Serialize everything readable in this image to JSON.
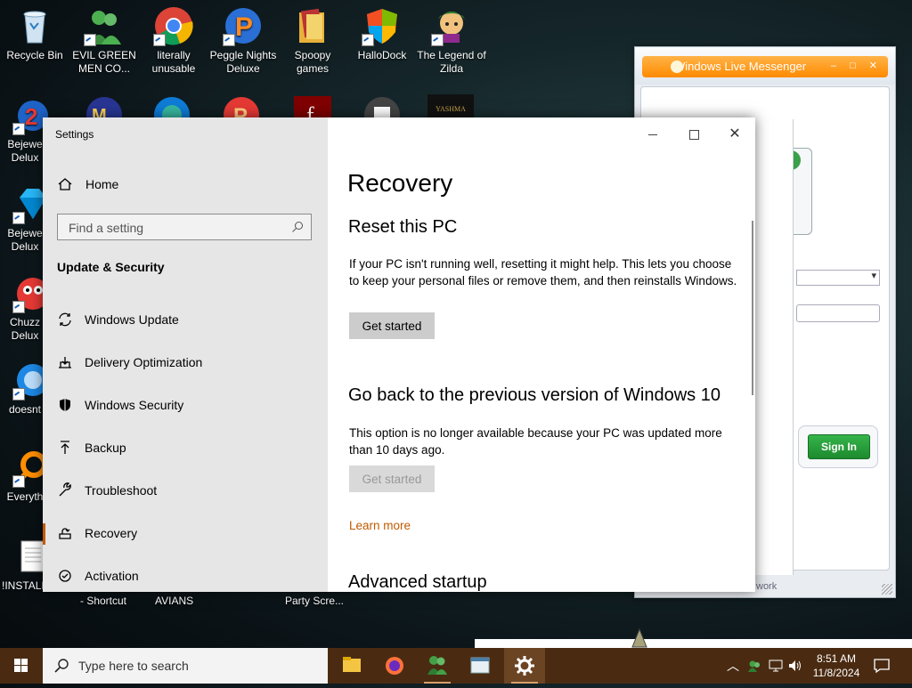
{
  "desktop": {
    "icons": [
      {
        "label": "Recycle Bin"
      },
      {
        "label": "EVIL GREEN MEN CO..."
      },
      {
        "label": "literally unusable"
      },
      {
        "label": "Peggle Nights Deluxe"
      },
      {
        "label": "Spoopy games"
      },
      {
        "label": "HalloDock"
      },
      {
        "label": "The Legend of Zilda"
      },
      {
        "label": "Bejewe Delux"
      },
      {
        "label": "Bejewe Delux"
      },
      {
        "label": "Chuzz Delux"
      },
      {
        "label": "doesnt"
      },
      {
        "label": "Everyth"
      },
      {
        "label": "!INSTALL"
      }
    ],
    "under_labels": [
      "- Shortcut",
      "AVIANS",
      "Party Scre..."
    ]
  },
  "messenger": {
    "title": "Windows Live Messenger",
    "sign_in_label": "Sign In",
    "network_text": "work"
  },
  "settings": {
    "window_title": "Settings",
    "home_label": "Home",
    "search_placeholder": "Find a setting",
    "section_title": "Update & Security",
    "nav": [
      {
        "label": "Windows Update",
        "icon": "sync-icon"
      },
      {
        "label": "Delivery Optimization",
        "icon": "delivery-icon"
      },
      {
        "label": "Windows Security",
        "icon": "shield-icon"
      },
      {
        "label": "Backup",
        "icon": "upload-arrow-icon"
      },
      {
        "label": "Troubleshoot",
        "icon": "wrench-icon"
      },
      {
        "label": "Recovery",
        "icon": "recovery-icon",
        "active": true
      },
      {
        "label": "Activation",
        "icon": "activation-icon"
      }
    ],
    "page_title": "Recovery",
    "reset": {
      "title": "Reset this PC",
      "text": "If your PC isn't running well, resetting it might help. This lets you choose to keep your personal files or remove them, and then reinstalls Windows.",
      "button": "Get started"
    },
    "goback": {
      "title": "Go back to the previous version of Windows 10",
      "text": "This option is no longer available because your PC was updated more than 10 days ago.",
      "button": "Get started",
      "link": "Learn more"
    },
    "advanced": {
      "title": "Advanced startup"
    }
  },
  "taskbar": {
    "search_placeholder": "Type here to search",
    "time": "8:51 AM",
    "date": "11/8/2024",
    "accent": "#4a2b12"
  }
}
